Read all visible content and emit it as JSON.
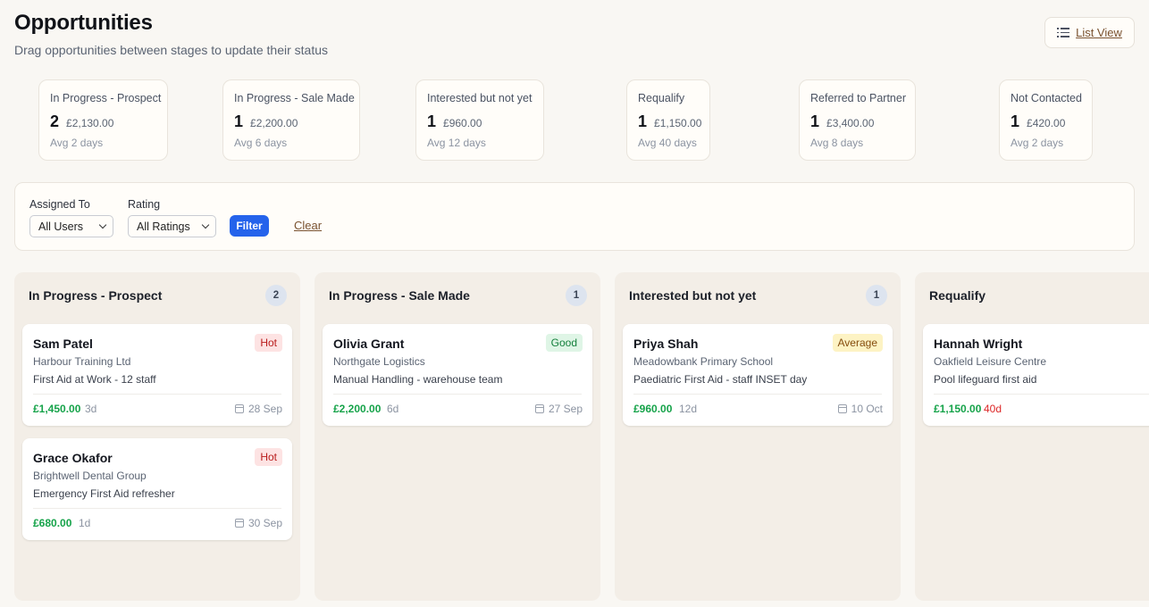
{
  "header": {
    "title": "Opportunities",
    "subtitle": "Drag opportunities between stages to update their status",
    "list_view_label": "List View"
  },
  "stats": [
    {
      "label": "In Progress - Prospect",
      "count": "2",
      "value": "£2,130.00",
      "avg": "Avg 2 days"
    },
    {
      "label": "In Progress - Sale Made",
      "count": "1",
      "value": "£2,200.00",
      "avg": "Avg 6 days"
    },
    {
      "label": "Interested but not yet",
      "count": "1",
      "value": "£960.00",
      "avg": "Avg 12 days"
    },
    {
      "label": "Requalify",
      "count": "1",
      "value": "£1,150.00",
      "avg": "Avg 40 days"
    },
    {
      "label": "Referred to Partner",
      "count": "1",
      "value": "£3,400.00",
      "avg": "Avg 8 days"
    },
    {
      "label": "Not Contacted",
      "count": "1",
      "value": "£420.00",
      "avg": "Avg 2 days"
    }
  ],
  "filters": {
    "assigned_label": "Assigned To",
    "assigned_value": "All Users",
    "rating_label": "Rating",
    "rating_value": "All Ratings",
    "filter_button": "Filter",
    "clear_link": "Clear"
  },
  "columns": [
    {
      "title": "In Progress - Prospect",
      "count": "2",
      "cards": [
        {
          "name": "Sam Patel",
          "org": "Harbour Training Ltd",
          "desc": "First Aid at Work - 12 staff",
          "rating": "Hot",
          "value": "£1,450.00",
          "age": "3d",
          "date": "28 Sep"
        },
        {
          "name": "Grace Okafor",
          "org": "Brightwell Dental Group",
          "desc": "Emergency First Aid refresher",
          "rating": "Hot",
          "value": "£680.00",
          "age": "1d",
          "date": "30 Sep"
        }
      ]
    },
    {
      "title": "In Progress - Sale Made",
      "count": "1",
      "cards": [
        {
          "name": "Olivia Grant",
          "org": "Northgate Logistics",
          "desc": "Manual Handling - warehouse team",
          "rating": "Good",
          "value": "£2,200.00",
          "age": "6d",
          "date": "27 Sep"
        }
      ]
    },
    {
      "title": "Interested but not yet",
      "count": "1",
      "cards": [
        {
          "name": "Priya Shah",
          "org": "Meadowbank Primary School",
          "desc": "Paediatric First Aid - staff INSET day",
          "rating": "Average",
          "value": "£960.00",
          "age": "12d",
          "date": "10 Oct"
        }
      ]
    },
    {
      "title": "Requalify",
      "count": "",
      "cards": [
        {
          "name": "Hannah Wright",
          "org": "Oakfield Leisure Centre",
          "desc": "Pool lifeguard first aid",
          "value": "£1,150.00",
          "age": "40d"
        }
      ]
    }
  ],
  "colors": {
    "accent": "#2563eb",
    "money": "#16a34a",
    "overdue": "#dc2626",
    "link": "#7a5230"
  }
}
